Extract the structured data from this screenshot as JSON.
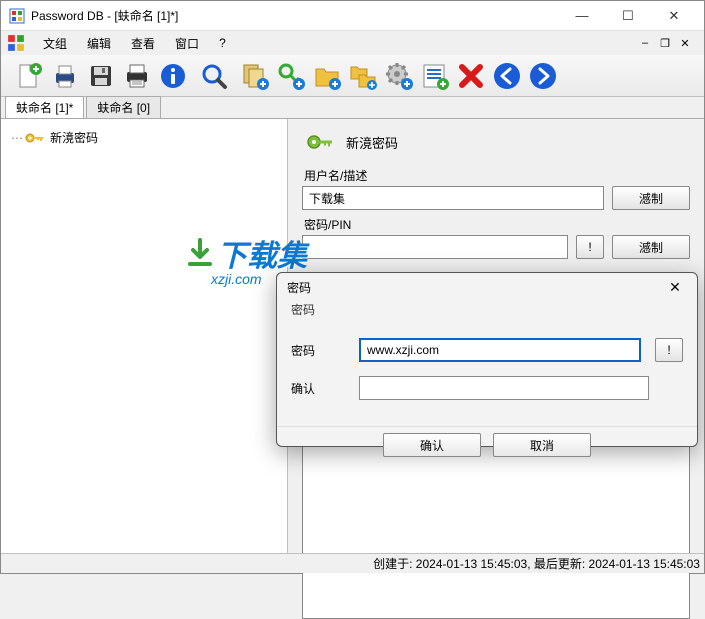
{
  "window": {
    "title": "Password DB - [蚨命名 [1]*]"
  },
  "menu": {
    "file": "文组",
    "edit": "编辑",
    "view": "查看",
    "window": "窗口",
    "help": "?"
  },
  "tabs": {
    "tab1": "蚨命名 [1]*",
    "tab2": "蚨命名 [0]"
  },
  "tree": {
    "item1": "新滰密码"
  },
  "detail": {
    "header": "新滰密码",
    "username_label": "用户名/描述",
    "username_value": "下载集",
    "password_label": "密码/PIN",
    "password_value": "",
    "copy_btn": "澸制",
    "reveal_btn": "!"
  },
  "modal": {
    "title": "密码",
    "subtitle": "密码",
    "password_label": "密码",
    "password_value": "www.xzji.com",
    "confirm_label": "确认",
    "confirm_value": "",
    "reveal_btn": "!",
    "ok_btn": "确认",
    "cancel_btn": "取消"
  },
  "status": {
    "text": "创建于: 2024-01-13 15:45:03, 最后更新: 2024-01-13 15:45:03"
  },
  "watermark": {
    "main": "下载集",
    "sub": "xzji.com"
  }
}
